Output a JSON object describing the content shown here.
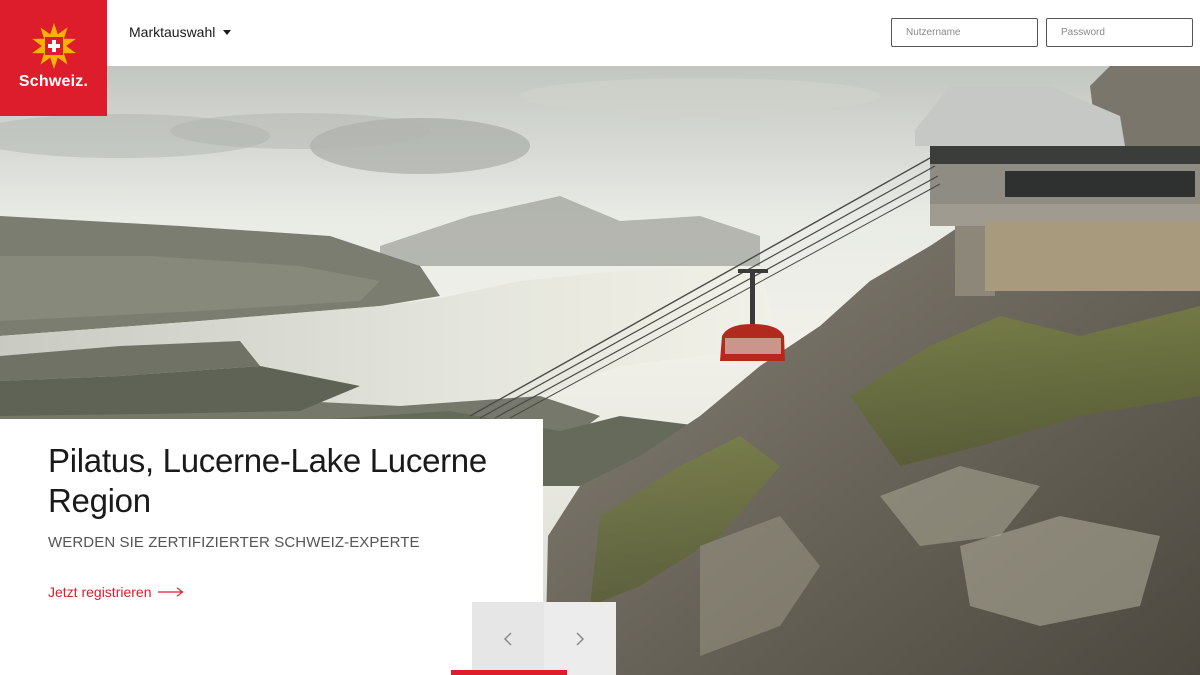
{
  "header": {
    "logo_text": "Schweiz.",
    "market_select_label": "Marktauswahl",
    "username_placeholder": "Nutzername",
    "password_placeholder": "Password"
  },
  "hero": {
    "title": "Pilatus, Lucerne-Lake Lucerne Region",
    "subtitle": "WERDEN SIE ZERTIFIZIERTER SCHWEIZ-EXPERTE",
    "cta_label": "Jetzt registrieren"
  },
  "slider": {
    "prev_icon": "chevron-left-icon",
    "next_icon": "chevron-right-icon"
  },
  "colors": {
    "brand_red": "#dd1c2c",
    "text_dark": "#1a1a1a",
    "control_bg": "#e6e6e6"
  }
}
